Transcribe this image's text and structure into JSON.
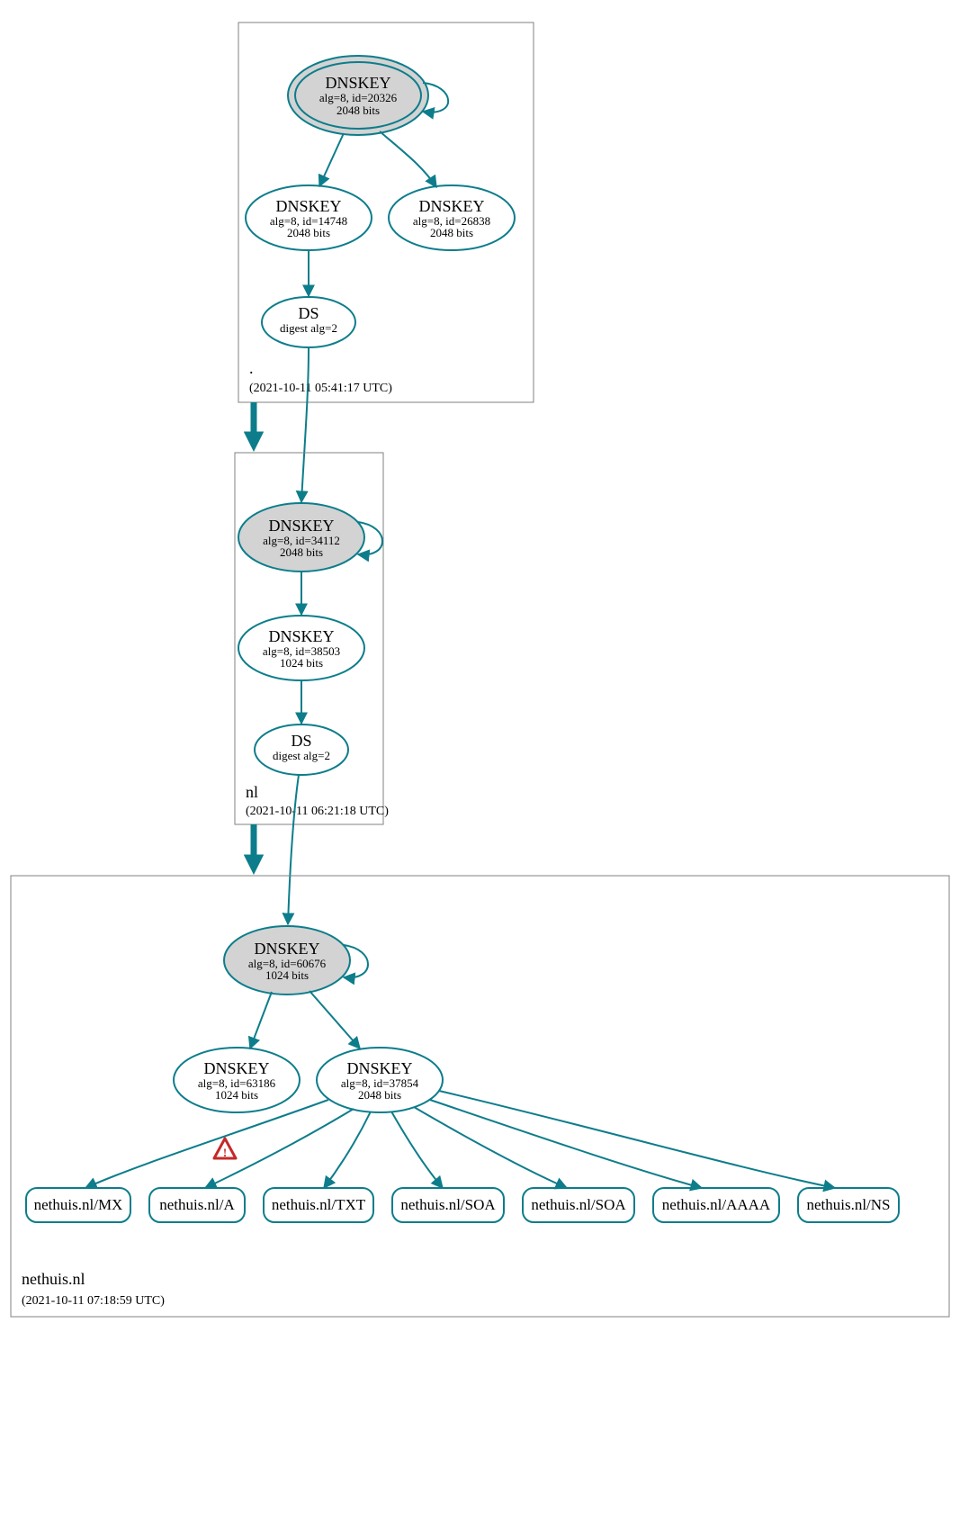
{
  "colors": {
    "stroke": "#0d7d8b",
    "ksk_fill": "#d3d3d3",
    "warn": "#c62828"
  },
  "zones": [
    {
      "id": "root",
      "name_label": ".",
      "date_label": "(2021-10-11 05:41:17 UTC)",
      "nodes": {
        "ksk": {
          "title": "DNSKEY",
          "l2": "alg=8, id=20326",
          "l3": "2048 bits"
        },
        "zsk1": {
          "title": "DNSKEY",
          "l2": "alg=8, id=14748",
          "l3": "2048 bits"
        },
        "zsk2": {
          "title": "DNSKEY",
          "l2": "alg=8, id=26838",
          "l3": "2048 bits"
        },
        "ds": {
          "title": "DS",
          "l2": "digest alg=2"
        }
      }
    },
    {
      "id": "nl",
      "name_label": "nl",
      "date_label": "(2021-10-11 06:21:18 UTC)",
      "nodes": {
        "ksk": {
          "title": "DNSKEY",
          "l2": "alg=8, id=34112",
          "l3": "2048 bits"
        },
        "zsk": {
          "title": "DNSKEY",
          "l2": "alg=8, id=38503",
          "l3": "1024 bits"
        },
        "ds": {
          "title": "DS",
          "l2": "digest alg=2"
        }
      }
    },
    {
      "id": "nethuis",
      "name_label": "nethuis.nl",
      "date_label": "(2021-10-11 07:18:59 UTC)",
      "nodes": {
        "ksk": {
          "title": "DNSKEY",
          "l2": "alg=8, id=60676",
          "l3": "1024 bits"
        },
        "zsk1": {
          "title": "DNSKEY",
          "l2": "alg=8, id=63186",
          "l3": "1024 bits"
        },
        "zsk2": {
          "title": "DNSKEY",
          "l2": "alg=8, id=37854",
          "l3": "2048 bits"
        }
      },
      "rrsets": [
        {
          "label": "nethuis.nl/MX"
        },
        {
          "label": "nethuis.nl/A"
        },
        {
          "label": "nethuis.nl/TXT"
        },
        {
          "label": "nethuis.nl/SOA"
        },
        {
          "label": "nethuis.nl/SOA"
        },
        {
          "label": "nethuis.nl/AAAA"
        },
        {
          "label": "nethuis.nl/NS"
        }
      ]
    }
  ],
  "warning_icon": "⚠"
}
